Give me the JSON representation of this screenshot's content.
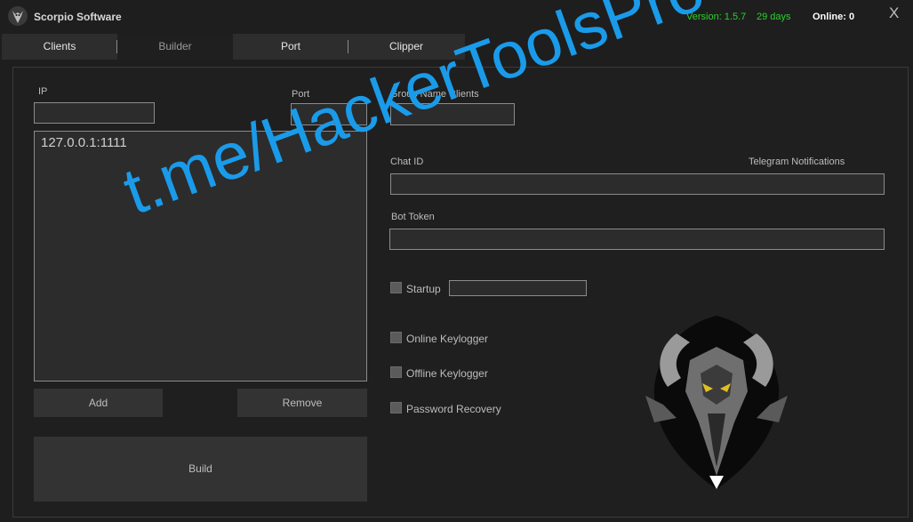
{
  "window": {
    "title": "Scorpio Software",
    "version": "Version: 1.5.7",
    "days": "29 days",
    "online": "Online: 0",
    "close_label": "X"
  },
  "tabs": [
    {
      "label": "Clients"
    },
    {
      "label": "Builder"
    },
    {
      "label": "Port"
    },
    {
      "label": "Clipper"
    }
  ],
  "builder": {
    "ip_label": "IP",
    "ip_value": "",
    "port_label": "Port",
    "port_value": "",
    "hosts": [
      "127.0.0.1:1111"
    ],
    "add_label": "Add",
    "remove_label": "Remove",
    "build_label": "Build",
    "group_label": "Group  Name Clients",
    "group_value": "",
    "chat_id_label": "Chat ID",
    "telegram_label": "Telegram Notifications",
    "chat_id_value": "",
    "bot_token_label": "Bot Token",
    "bot_token_value": "",
    "startup_label": "Startup",
    "startup_value": "",
    "checkboxes": [
      "Online Keylogger",
      "Offline Keylogger",
      "Password Recovery"
    ]
  },
  "watermark": "t.me/HackerToolsPro",
  "colors": {
    "accent_green": "#2bd12b",
    "watermark_blue": "#1a9bea"
  }
}
